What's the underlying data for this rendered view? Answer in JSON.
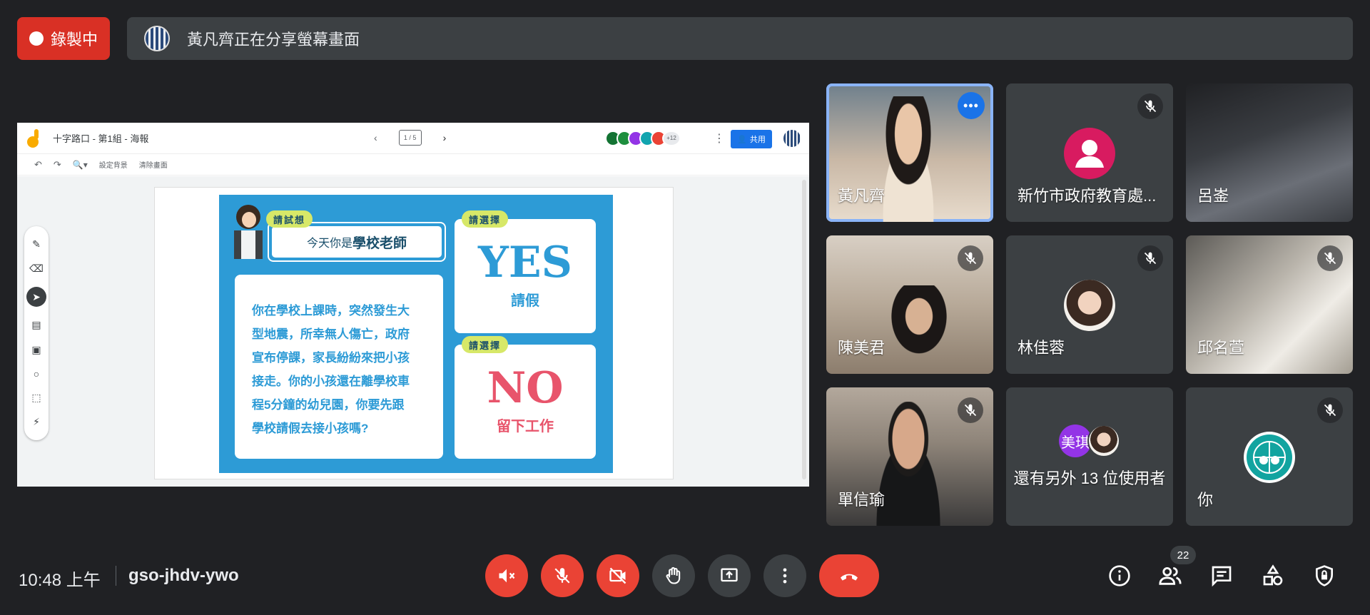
{
  "recording": {
    "label": "錄製中"
  },
  "share_banner": {
    "text": "黃凡齊正在分享螢幕畫面"
  },
  "jamboard": {
    "title": "十字路口 - 第1組 - 海報",
    "page_indicator": "1 / 5",
    "extra_collaborators": "+12",
    "share_label": "共用",
    "toolbar": {
      "set_background": "設定背景",
      "clear_frame": "清除畫面"
    }
  },
  "poster": {
    "tag_think": "請試想",
    "title_prefix": "今天你是",
    "title_bold": "學校老師",
    "body_lines": [
      "你在學校上課時，突然發生大",
      "型地震，所幸無人傷亡，政府",
      "宣布停課，家長紛紛來把小孩",
      "接走。你的小孩還在離學校車",
      "程5分鐘的幼兒園，你要先跟",
      "學校請假去接小孩嗎?"
    ],
    "tag_choose": "請選擇",
    "yes": "YES",
    "yes_sub": "請假",
    "no": "NO",
    "no_sub": "留下工作"
  },
  "participants": [
    {
      "name": "黃凡齊"
    },
    {
      "name": "新竹市政府教育處..."
    },
    {
      "name": "呂崟"
    },
    {
      "name": "陳美君"
    },
    {
      "name": "林佳蓉"
    },
    {
      "name": "邱名萱"
    },
    {
      "name": "單信瑜"
    },
    {
      "name": "還有另外 13 位使用者",
      "avatar_text": "美琪"
    },
    {
      "name": "你"
    }
  ],
  "bottom": {
    "time": "10:48 上午",
    "meeting_code": "gso-jhdv-ywo",
    "participant_count": "22"
  },
  "colors": {
    "danger": "#ea4335",
    "accent": "#1a73e8",
    "panel": "#3c4043",
    "poster_blue": "#2d9bd6",
    "poster_red": "#e8546b"
  }
}
